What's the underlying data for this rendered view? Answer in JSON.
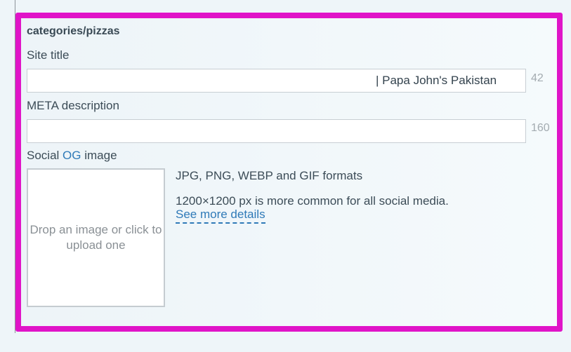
{
  "section": {
    "path_title": "categories/pizzas"
  },
  "site_title": {
    "label": "Site title",
    "value": "",
    "suffix": "| Papa John's Pakistan",
    "counter": "42"
  },
  "meta_description": {
    "label": "META description",
    "value": "",
    "counter": "160"
  },
  "social_og": {
    "label_prefix": "Social",
    "label_highlight": "OG",
    "label_suffix": "image",
    "dropzone_text": "Drop an image or click to upload one",
    "formats_text": "JPG, PNG, WEBP and GIF formats",
    "size_hint": "1200×1200 px is more common for all social media.",
    "details_link": "See more details"
  },
  "colors": {
    "frame_highlight": "#e014c8",
    "link": "#2f7ab8",
    "text": "#3c4c57",
    "counter": "#a3abb0"
  }
}
